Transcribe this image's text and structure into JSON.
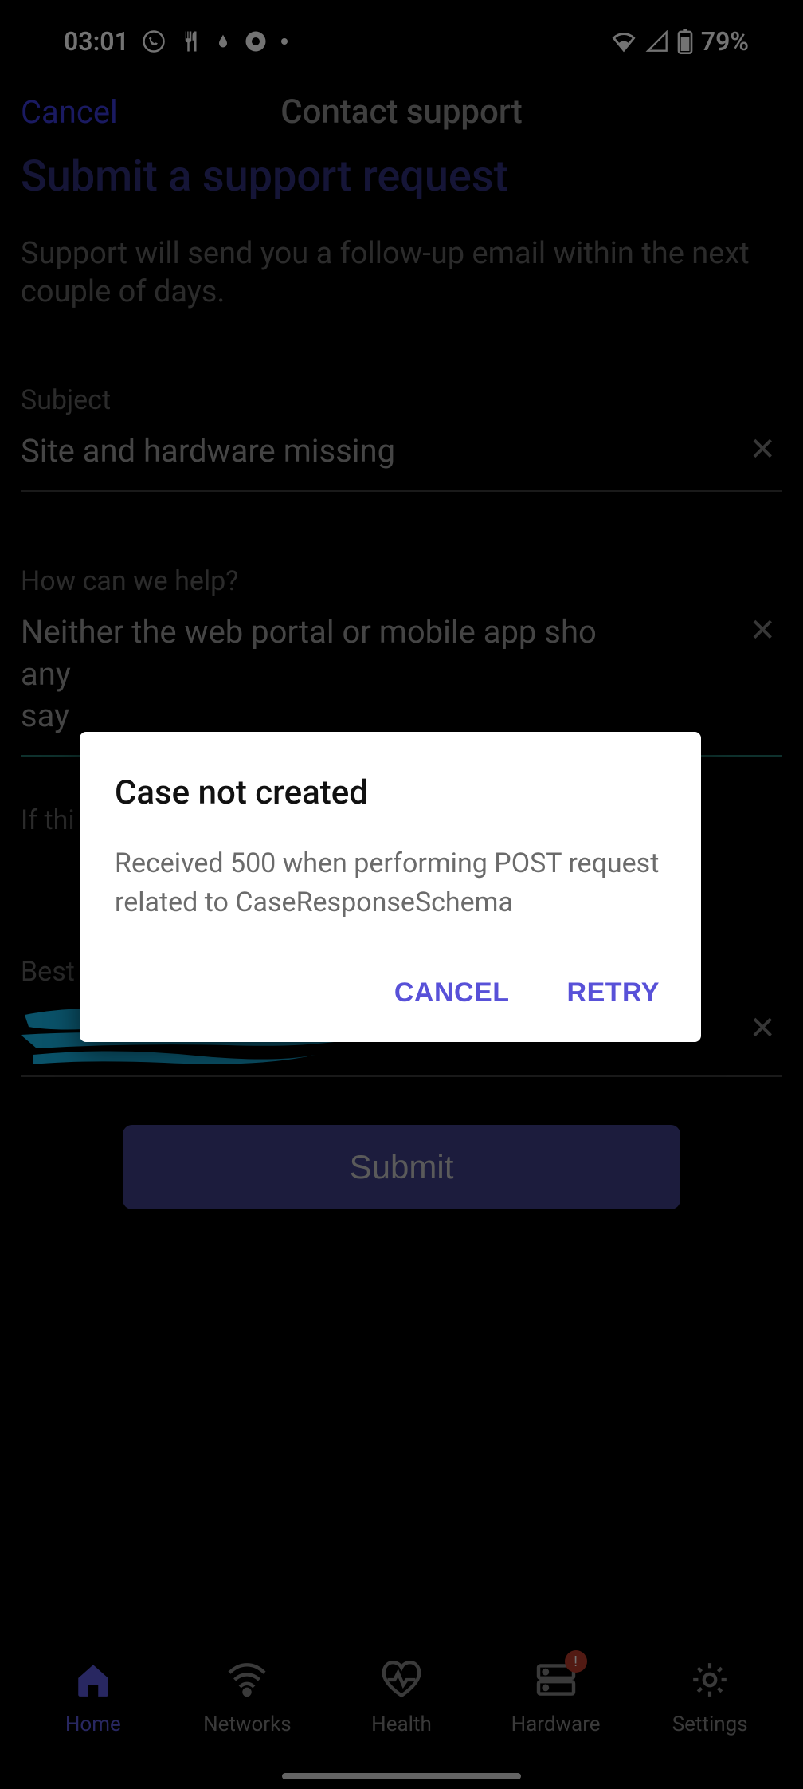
{
  "statusbar": {
    "time": "03:01",
    "battery": "79%"
  },
  "header": {
    "cancel": "Cancel",
    "title": "Contact support"
  },
  "page": {
    "title": "Submit a support request",
    "blurb": "Support will send you a follow-up email within the next couple of days."
  },
  "form": {
    "subject_label": "Subject",
    "subject_value": "Site and hardware missing",
    "help_label": "How can we help?",
    "help_value": "Neither the web portal or mobile app sho\nany\nsay",
    "site_label": "If thi",
    "email_label": "Best email address to reach you",
    "email_value": "",
    "submit": "Submit",
    "clear_icon": "✕"
  },
  "dialog": {
    "title": "Case not created",
    "message": "Received 500 when performing POST request related to CaseResponseSchema",
    "cancel": "CANCEL",
    "retry": "RETRY"
  },
  "nav": {
    "home": "Home",
    "networks": "Networks",
    "health": "Health",
    "hardware": "Hardware",
    "settings": "Settings",
    "hardware_badge": "!"
  }
}
